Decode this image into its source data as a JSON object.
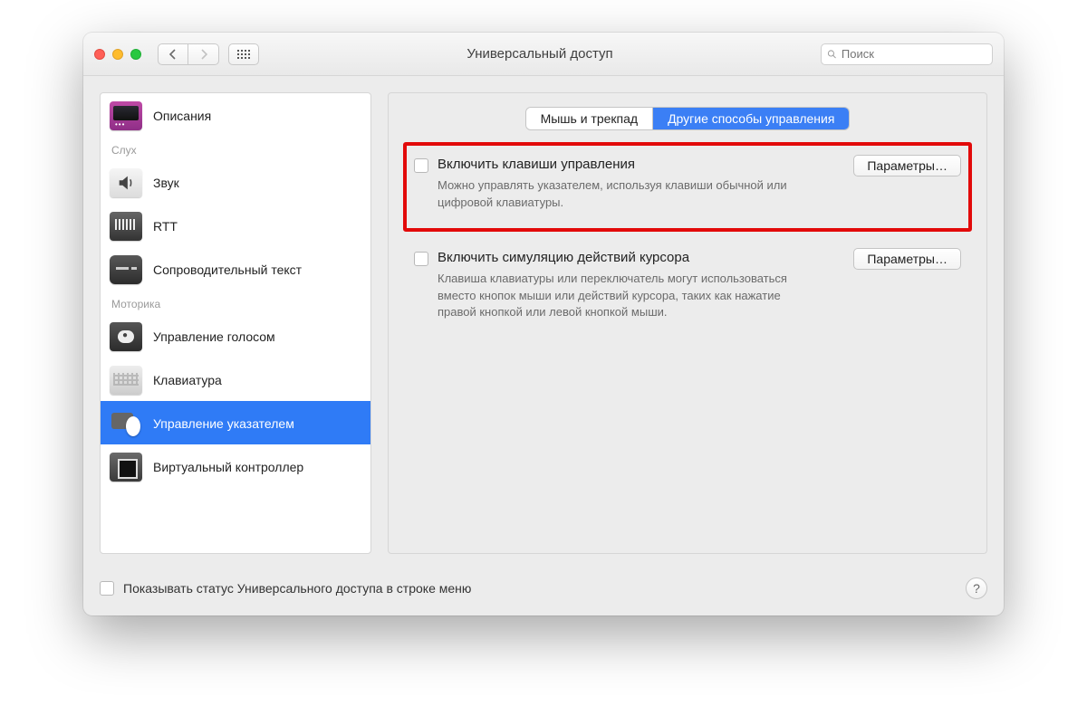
{
  "window": {
    "title": "Универсальный доступ"
  },
  "search": {
    "placeholder": "Поиск"
  },
  "sidebar": {
    "categories": [
      {
        "label": "",
        "items": [
          {
            "label": "Описания",
            "icon": "descriptions-icon"
          }
        ]
      },
      {
        "label": "Слух",
        "items": [
          {
            "label": "Звук",
            "icon": "sound-icon"
          },
          {
            "label": "RTT",
            "icon": "rtt-icon"
          },
          {
            "label": "Сопроводительный текст",
            "icon": "captions-icon"
          }
        ]
      },
      {
        "label": "Моторика",
        "items": [
          {
            "label": "Управление голосом",
            "icon": "voice-control-icon"
          },
          {
            "label": "Клавиатура",
            "icon": "keyboard-icon"
          },
          {
            "label": "Управление указателем",
            "icon": "pointer-control-icon",
            "selected": true
          },
          {
            "label": "Виртуальный контроллер",
            "icon": "virtual-controller-icon"
          }
        ]
      }
    ]
  },
  "tabs": {
    "items": [
      {
        "label": "Мышь и трекпад",
        "active": false
      },
      {
        "label": "Другие способы управления",
        "active": true
      }
    ]
  },
  "settings": [
    {
      "title": "Включить клавиши управления",
      "desc": "Можно управлять указателем, используя клавиши обычной или цифровой клавиатуры.",
      "button": "Параметры…",
      "highlighted": true
    },
    {
      "title": "Включить симуляцию действий курсора",
      "desc": "Клавиша клавиатуры или переключатель могут использоваться вместо кнопок мыши или действий курсора, таких как нажатие правой кнопкой или левой кнопкой мыши.",
      "button": "Параметры…",
      "highlighted": false
    }
  ],
  "footer": {
    "label": "Показывать статус Универсального доступа в строке меню"
  }
}
